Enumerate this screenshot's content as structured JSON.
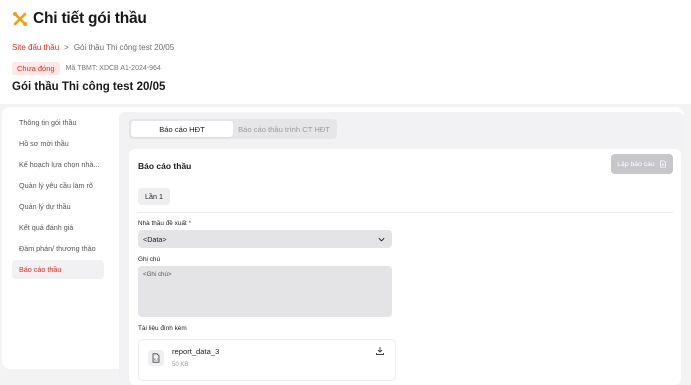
{
  "header": {
    "title": "Chi tiết gói thầu",
    "breadcrumb": {
      "root": "Site đấu thầu",
      "separator": ">",
      "current": "Gói thầu Thi công test 20/05"
    },
    "status": "Chưa đóng",
    "code": "Mã TBMT: XDCB A1-2024-964",
    "package_name": "Gói thầu Thi công test 20/05",
    "accent": "#f59e0b"
  },
  "sidebar": {
    "items": [
      {
        "label": "Thông tin gói thầu"
      },
      {
        "label": "Hồ sơ mời thầu"
      },
      {
        "label": "Kế hoạch lựa chọn nhà..."
      },
      {
        "label": "Quản lý yêu cầu làm rõ"
      },
      {
        "label": "Quản lý dự thầu"
      },
      {
        "label": "Kết quả đánh giá"
      },
      {
        "label": "Đàm phán/ thương thảo"
      },
      {
        "label": "Báo cáo thầu"
      }
    ],
    "active_index": 7
  },
  "tabs": [
    {
      "label": "Báo cáo HĐT"
    },
    {
      "label": "Báo cáo thầu trình CT HĐT"
    }
  ],
  "report": {
    "title": "Báo cáo thầu",
    "create_button": "Lập báo cáo",
    "attempt": "Lần 1",
    "contractor_label": "Nhà thầu đề xuất",
    "required_mark": "*",
    "contractor_value": "<Data>",
    "note_label": "Ghi chú",
    "note_value": "<Ghi chú>",
    "attachments_label": "Tài liệu đính kèm",
    "file": {
      "name": "report_data_3",
      "size": "50 KB",
      "type": "XLS"
    }
  }
}
